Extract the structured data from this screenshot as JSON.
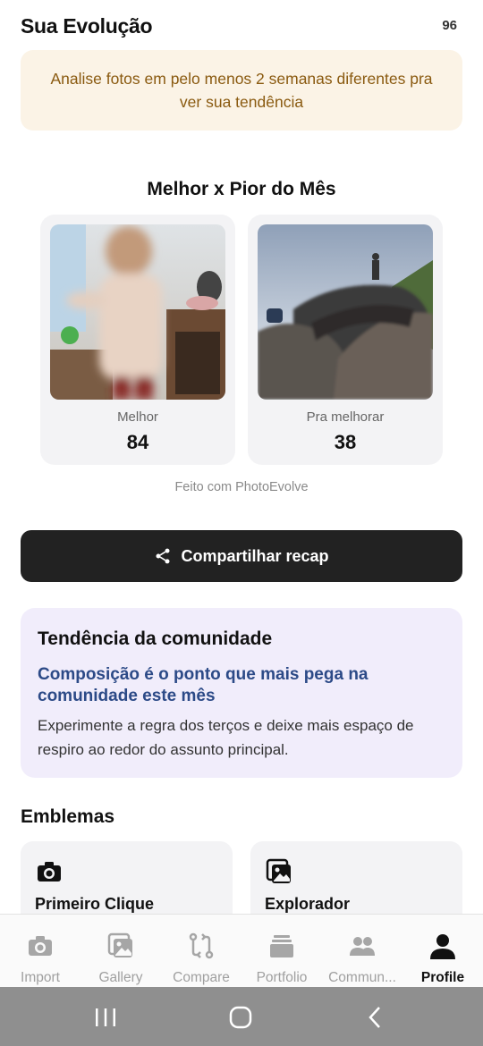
{
  "header": {
    "title": "Sua Evolução",
    "score": "96"
  },
  "hint": {
    "text": "Analise fotos em pelo menos 2 semanas diferentes pra ver sua tendência"
  },
  "recap": {
    "title": "Melhor x Pior do Mês",
    "best": {
      "label": "Melhor",
      "value": "84"
    },
    "worst": {
      "label": "Pra melhorar",
      "value": "38"
    },
    "made_with": "Feito com PhotoEvolve",
    "share_label": "Compartilhar recap"
  },
  "trend": {
    "heading": "Tendência da comunidade",
    "subheading": "Composição é o ponto que mais pega na comunidade este mês",
    "body": "Experimente a regra dos terços e deixe mais espaço de respiro ao redor do assunto principal."
  },
  "emblems": {
    "title": "Emblemas",
    "items": [
      {
        "name": "Primeiro Clique",
        "icon": "camera-icon"
      },
      {
        "name": "Explorador",
        "icon": "gallery-icon"
      }
    ]
  },
  "tabs": [
    {
      "label": "Import",
      "icon": "camera-icon",
      "active": false
    },
    {
      "label": "Gallery",
      "icon": "gallery-icon",
      "active": false
    },
    {
      "label": "Compare",
      "icon": "compare-icon",
      "active": false
    },
    {
      "label": "Portfolio",
      "icon": "portfolio-icon",
      "active": false
    },
    {
      "label": "Commun...",
      "icon": "community-icon",
      "active": false
    },
    {
      "label": "Profile",
      "icon": "profile-icon",
      "active": true
    }
  ],
  "colors": {
    "accent_dark": "#222222",
    "hint_bg": "#fbf3e6",
    "hint_text": "#8a5a10",
    "trend_bg": "#f1edfb",
    "trend_accent": "#2c4a87"
  }
}
